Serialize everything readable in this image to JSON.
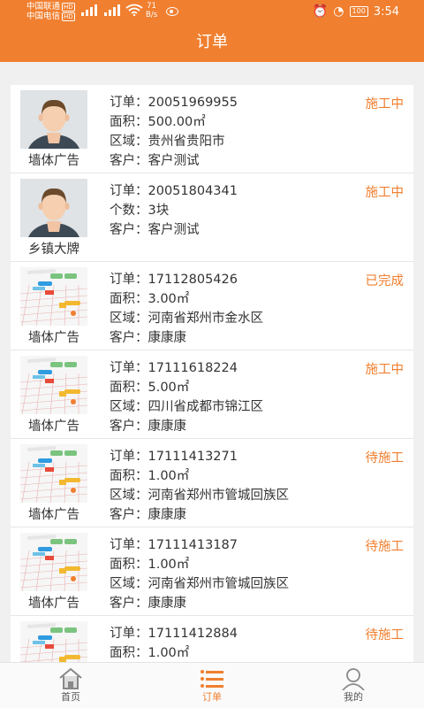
{
  "status_bar": {
    "carrier1": "中国联通",
    "carrier2": "中国电信",
    "hd": "HD",
    "net_speed_value": "71",
    "net_speed_unit": "B/s",
    "battery": "100",
    "time": "3:54"
  },
  "header": {
    "title": "订单"
  },
  "labels": {
    "order": "订单：",
    "area": "面积：",
    "count": "个数：",
    "region": "区域：",
    "customer": "客户："
  },
  "orders": [
    {
      "thumb": "avatar",
      "category": "墙体广告",
      "order_no": "20051969955",
      "status": "施工中",
      "metric_label": "面积：",
      "metric": "500.00㎡",
      "region": "贵州省贵阳市",
      "customer": "客户测试"
    },
    {
      "thumb": "avatar",
      "category": "乡镇大牌",
      "order_no": "20051804341",
      "status": "施工中",
      "metric_label": "个数：",
      "metric": "3块",
      "region": "",
      "customer": "客户测试"
    },
    {
      "thumb": "map",
      "category": "墙体广告",
      "order_no": "17112805426",
      "status": "已完成",
      "metric_label": "面积：",
      "metric": "3.00㎡",
      "region": "河南省郑州市金水区",
      "customer": "康康康"
    },
    {
      "thumb": "map",
      "category": "墙体广告",
      "order_no": "17111618224",
      "status": "施工中",
      "metric_label": "面积：",
      "metric": "5.00㎡",
      "region": "四川省成都市锦江区",
      "customer": "康康康"
    },
    {
      "thumb": "map",
      "category": "墙体广告",
      "order_no": "17111413271",
      "status": "待施工",
      "metric_label": "面积：",
      "metric": "1.00㎡",
      "region": "河南省郑州市管城回族区",
      "customer": "康康康"
    },
    {
      "thumb": "map",
      "category": "墙体广告",
      "order_no": "17111413187",
      "status": "待施工",
      "metric_label": "面积：",
      "metric": "1.00㎡",
      "region": "河南省郑州市管城回族区",
      "customer": "康康康"
    },
    {
      "thumb": "map",
      "category": "",
      "order_no": "17111412884",
      "status": "待施工",
      "metric_label": "面积：",
      "metric": "1.00㎡",
      "region": "",
      "customer": ""
    }
  ],
  "nav": {
    "home": "首页",
    "orders": "订单",
    "mine": "我的",
    "active_color": "#f07f2f"
  },
  "colors": {
    "brand": "#f07f2f"
  }
}
